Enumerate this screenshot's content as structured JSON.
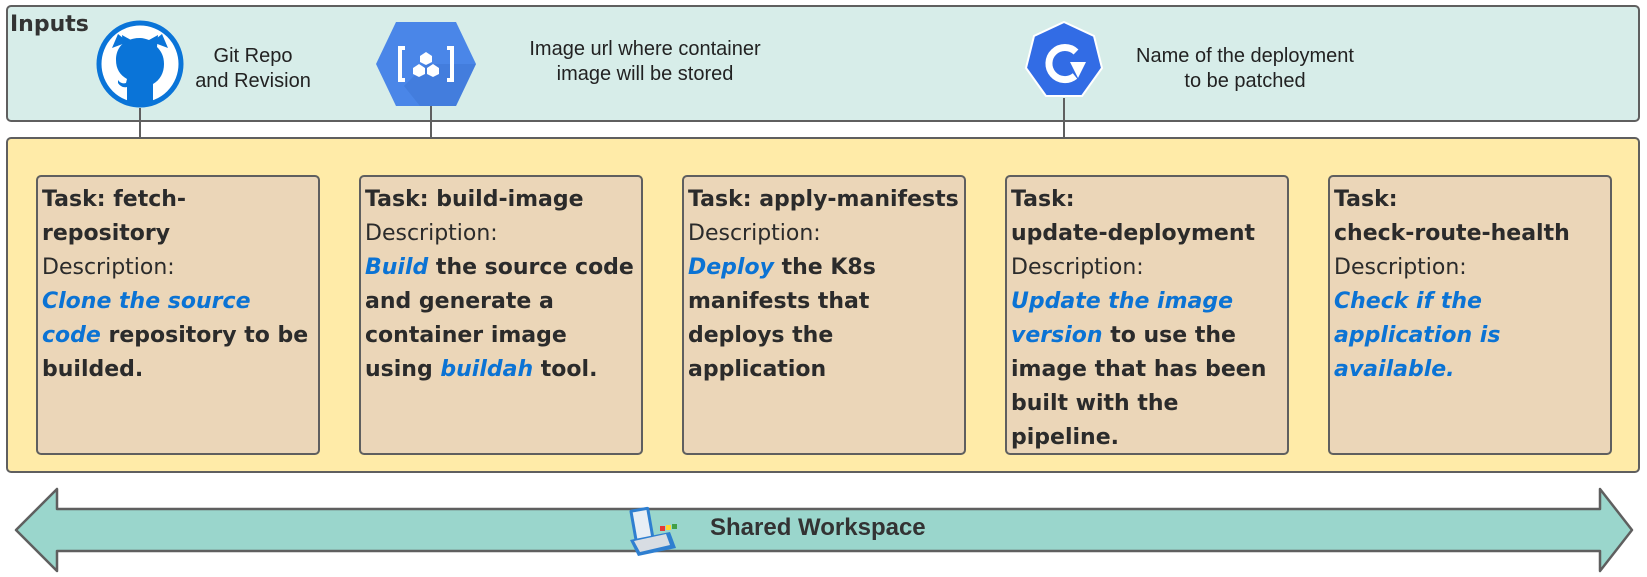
{
  "inputs": {
    "title": "Inputs",
    "items": [
      {
        "icon": "github-icon",
        "line1": "Git Repo",
        "line2": "and Revision"
      },
      {
        "icon": "container-registry-icon",
        "line1": "Image url where container",
        "line2": "image will be stored"
      },
      {
        "icon": "kubernetes-deployment-icon",
        "line1": "Name of the deployment",
        "line2": "to be patched"
      }
    ]
  },
  "tasks": [
    {
      "title_line1": "Task: fetch-repository",
      "title_line2": "",
      "desc_label": "Description:",
      "segments": [
        {
          "text": "Clone the source code",
          "highlight": true
        },
        {
          "text": " repository to be builded.",
          "highlight": false
        }
      ]
    },
    {
      "title_line1": "Task: build-image",
      "title_line2": "",
      "desc_label": "Description:",
      "segments": [
        {
          "text": "Build",
          "highlight": true
        },
        {
          "text": " the source code and generate a container image using ",
          "highlight": false
        },
        {
          "text": "buildah",
          "highlight": true
        },
        {
          "text": " tool.",
          "highlight": false
        }
      ]
    },
    {
      "title_line1": "Task: apply-manifests",
      "title_line2": "",
      "desc_label": "Description:",
      "segments": [
        {
          "text": "Deploy",
          "highlight": true
        },
        {
          "text": " the K8s manifests that deploys the application",
          "highlight": false
        }
      ]
    },
    {
      "title_line1": "Task:",
      "title_line2": "update-deployment",
      "desc_label": "Description:",
      "segments": [
        {
          "text": "Update the image version",
          "highlight": true
        },
        {
          "text": " to use the image that has been built with the pipeline.",
          "highlight": false
        }
      ]
    },
    {
      "title_line1": "Task:",
      "title_line2": "check-route-health",
      "desc_label": "Description:",
      "segments": [
        {
          "text": "Check if the application is available.",
          "highlight": true
        }
      ]
    }
  ],
  "workspace": {
    "label": "Shared Workspace",
    "icon": "toolbox-icon"
  },
  "colors": {
    "inputs_bg": "#d7ede9",
    "pipeline_bg": "#ffeba8",
    "task_bg": "#ebd6b8",
    "highlight": "#0b73d4",
    "workspace_arrow": "#9ad6cc",
    "icon_blue": "#0a74d8",
    "gcp_blue": "#4a86e8",
    "k8s_blue": "#326ce5"
  }
}
